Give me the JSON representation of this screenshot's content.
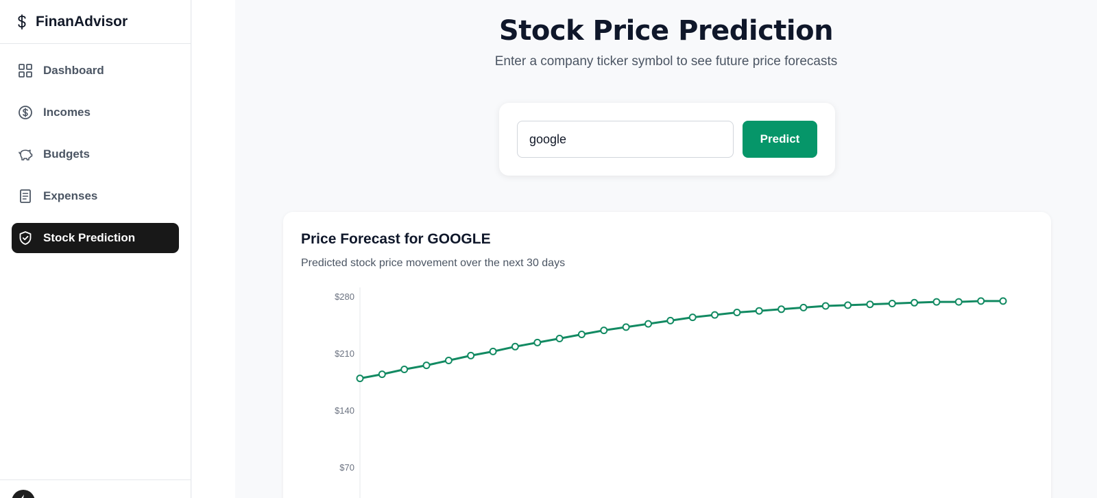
{
  "brand": {
    "name": "FinanAdvisor",
    "icon": "dollar-sign-icon"
  },
  "sidebar": {
    "items": [
      {
        "label": "Dashboard",
        "icon": "grid-icon",
        "active": false
      },
      {
        "label": "Incomes",
        "icon": "coin-icon",
        "active": false
      },
      {
        "label": "Budgets",
        "icon": "piggy-bank-icon",
        "active": false
      },
      {
        "label": "Expenses",
        "icon": "receipt-icon",
        "active": false
      },
      {
        "label": "Stock Prediction",
        "icon": "shield-check-icon",
        "active": true
      }
    ]
  },
  "header": {
    "title": "Stock Price Prediction",
    "subtitle": "Enter a company ticker symbol to see future price forecasts"
  },
  "search": {
    "value": "google",
    "placeholder": "",
    "button_label": "Predict"
  },
  "chart": {
    "title": "Price Forecast for GOOGLE",
    "subtitle": "Predicted stock price movement over the next 30 days"
  },
  "colors": {
    "accent": "#069669",
    "line": "#128a62",
    "active_nav": "#181818"
  },
  "chart_data": {
    "type": "line",
    "title": "Price Forecast for GOOGLE",
    "xlabel": "",
    "ylabel": "",
    "ylim": [
      0,
      280
    ],
    "yticks": [
      "$280",
      "$210",
      "$140",
      "$70"
    ],
    "ytick_values": [
      280,
      210,
      140,
      70
    ],
    "grid": false,
    "series": [
      {
        "values": [
          180,
          185,
          191,
          196,
          202,
          208,
          213,
          219,
          224,
          229,
          234,
          239,
          243,
          247,
          251,
          255,
          258,
          261,
          263,
          265,
          267,
          269,
          270,
          271,
          272,
          273,
          274,
          274,
          275,
          275
        ]
      }
    ]
  }
}
